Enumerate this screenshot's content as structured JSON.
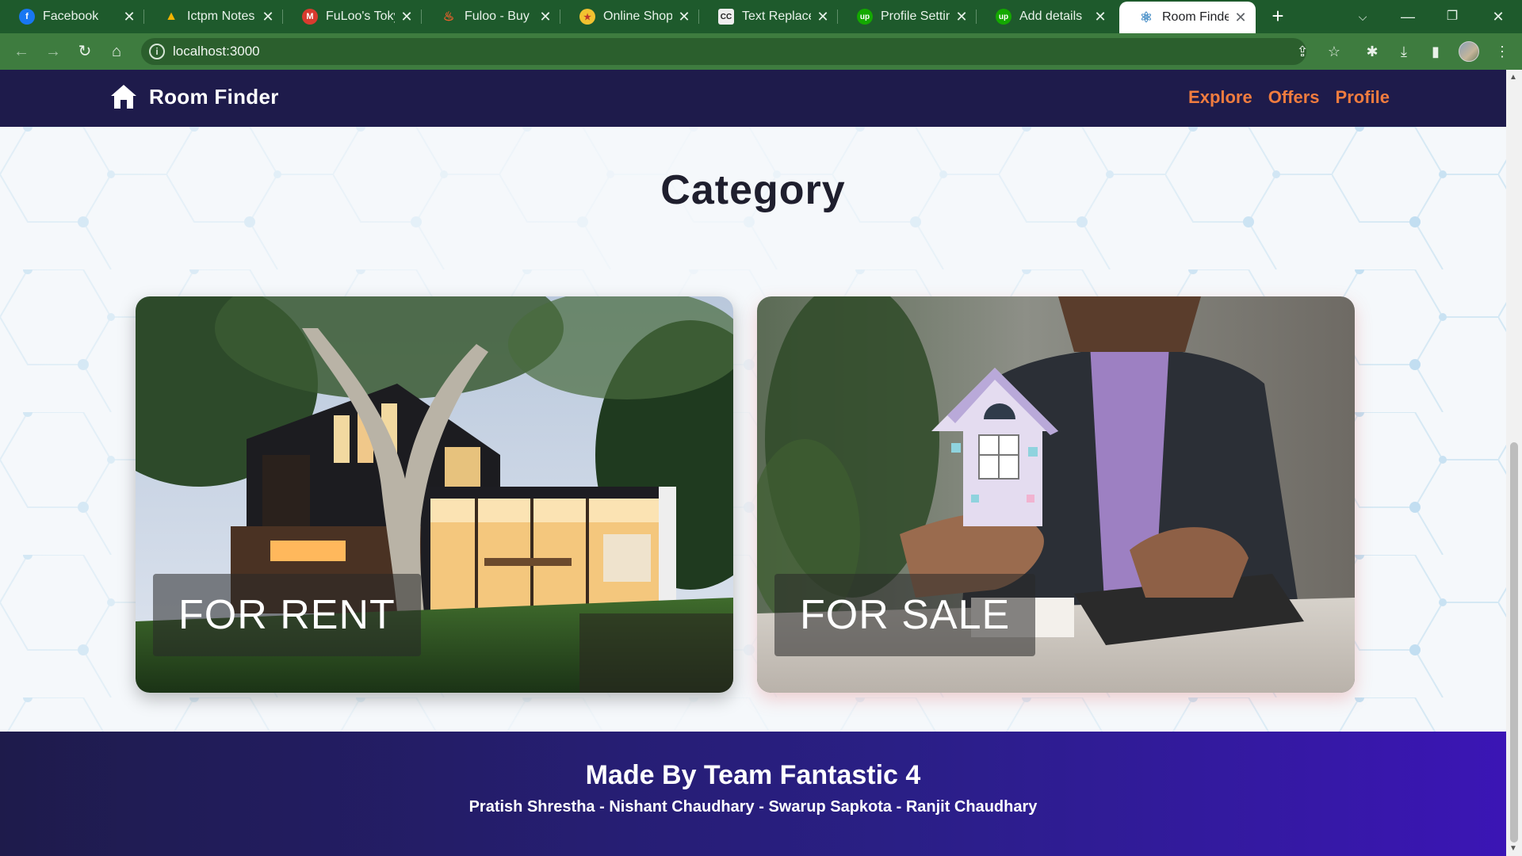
{
  "browser": {
    "tabs": [
      {
        "title": "Facebook",
        "favicon_color": "#1877f2",
        "favicon_glyph": "f",
        "active": false
      },
      {
        "title": "Ictpm Notes a",
        "favicon_color": "#f4b400",
        "favicon_glyph": "▲",
        "active": false
      },
      {
        "title": "FuLoo's Tokyo",
        "favicon_color": "#d93b2f",
        "favicon_glyph": "M",
        "active": false
      },
      {
        "title": "Fuloo - Buy Fu",
        "favicon_color": "#e8602c",
        "favicon_glyph": "♨",
        "active": false
      },
      {
        "title": "Online Shoppi",
        "favicon_color": "#f2c230",
        "favicon_glyph": "★",
        "active": false
      },
      {
        "title": "Text Replacem",
        "favicon_color": "#444444",
        "favicon_glyph": "CC",
        "active": false
      },
      {
        "title": "Profile Setting",
        "favicon_color": "#14a800",
        "favicon_glyph": "up",
        "active": false
      },
      {
        "title": "Add details",
        "favicon_color": "#14a800",
        "favicon_glyph": "up",
        "active": false
      },
      {
        "title": "Room Finder",
        "favicon_color": "#61dafb",
        "favicon_glyph": "⚛",
        "active": true
      }
    ],
    "url": "localhost:3000",
    "accent_color": "#3e7c3f"
  },
  "nav": {
    "brand": "Room Finder",
    "links": [
      "Explore",
      "Offers",
      "Profile"
    ],
    "link_color": "#f07c3f"
  },
  "main": {
    "heading": "Category",
    "cards": [
      {
        "label": "FOR RENT",
        "image": "modern-house-photo"
      },
      {
        "label": "FOR SALE",
        "image": "man-holding-house-model-photo"
      }
    ]
  },
  "footer": {
    "title": "Made By Team Fantastic 4",
    "names": "Pratish Shrestha - Nishant Chaudhary - Swarup Sapkota - Ranjit Chaudhary"
  }
}
